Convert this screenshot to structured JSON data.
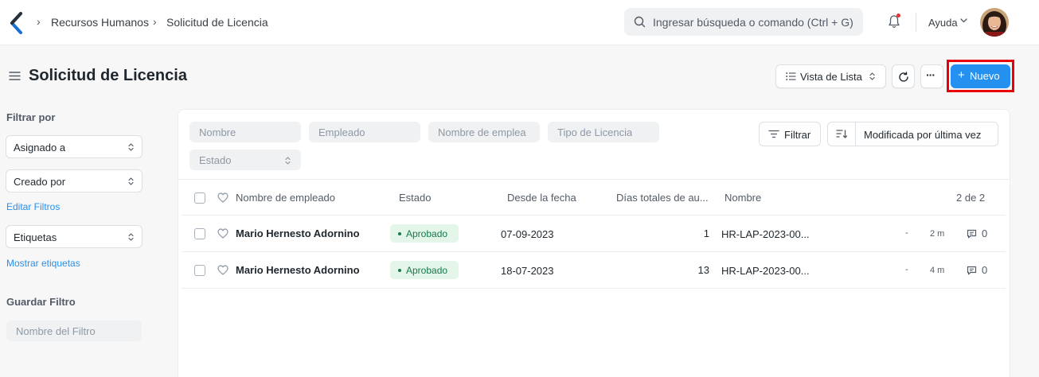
{
  "navbar": {
    "breadcrumbs": [
      "Recursos Humanos",
      "Solicitud de Licencia"
    ],
    "search_placeholder": "Ingresar búsqueda o comando (Ctrl + G)",
    "help_label": "Ayuda"
  },
  "page": {
    "title": "Solicitud de Licencia",
    "view_label": "Vista de Lista",
    "new_label": "Nuevo",
    "more_label": "···",
    "new_plus": "+"
  },
  "sidebar": {
    "filter_heading": "Filtrar por",
    "selects": [
      "Asignado a",
      "Creado por"
    ],
    "edit_filters_link": "Editar Filtros",
    "tags_select": "Etiquetas",
    "show_tags_link": "Mostrar etiquetas",
    "save_filter_heading": "Guardar Filtro",
    "filter_name_placeholder": "Nombre del Filtro"
  },
  "filters": {
    "fields": [
      "Nombre",
      "Empleado",
      "Nombre de emplea",
      "Tipo de Licencia",
      "Estado"
    ],
    "filter_button": "Filtrar",
    "sort_label": "Modificada por última vez"
  },
  "table": {
    "columns": [
      "Nombre de empleado",
      "Estado",
      "Desde la fecha",
      "Días totales de au...",
      "Nombre"
    ],
    "count": "2 de 2",
    "rows": [
      {
        "employee": "Mario Hernesto Adornino",
        "status": "Aprobado",
        "from_date": "07-09-2023",
        "total_days": "1",
        "name": "HR-LAP-2023-00...",
        "dash": "-",
        "modified": "2 m",
        "comments": "0"
      },
      {
        "employee": "Mario Hernesto Adornino",
        "status": "Aprobado",
        "from_date": "18-07-2023",
        "total_days": "13",
        "name": "HR-LAP-2023-00...",
        "dash": "-",
        "modified": "4 m",
        "comments": "0"
      }
    ]
  },
  "colors": {
    "accent": "#2490ef",
    "highlight": "#e8000b",
    "status_green": "#16794c",
    "status_green_bg": "#e4f5e9"
  }
}
